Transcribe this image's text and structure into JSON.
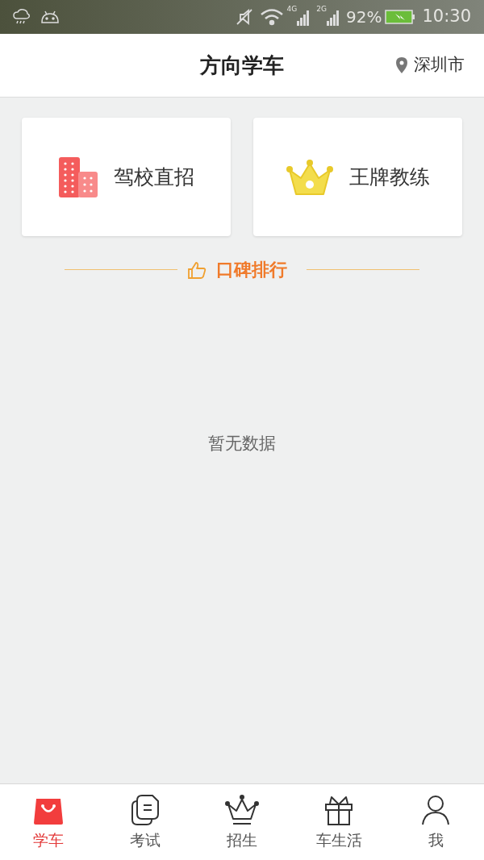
{
  "status_bar": {
    "network_4g": "4G",
    "network_2g": "2G",
    "battery": "92%",
    "time": "10:30"
  },
  "header": {
    "title": "方向学车",
    "location": "深圳市"
  },
  "cards": [
    {
      "kind": "building",
      "label": "驾校直招"
    },
    {
      "kind": "crown",
      "label": "王牌教练"
    }
  ],
  "section": {
    "title": "口碑排行"
  },
  "empty_message": "暂无数据",
  "tabs": [
    {
      "kind": "bag",
      "label": "学车",
      "selected": true
    },
    {
      "kind": "docs",
      "label": "考试",
      "selected": false
    },
    {
      "kind": "crown",
      "label": "招生",
      "selected": false
    },
    {
      "kind": "gift",
      "label": "车生活",
      "selected": false
    },
    {
      "kind": "person",
      "label": "我",
      "selected": false
    }
  ]
}
